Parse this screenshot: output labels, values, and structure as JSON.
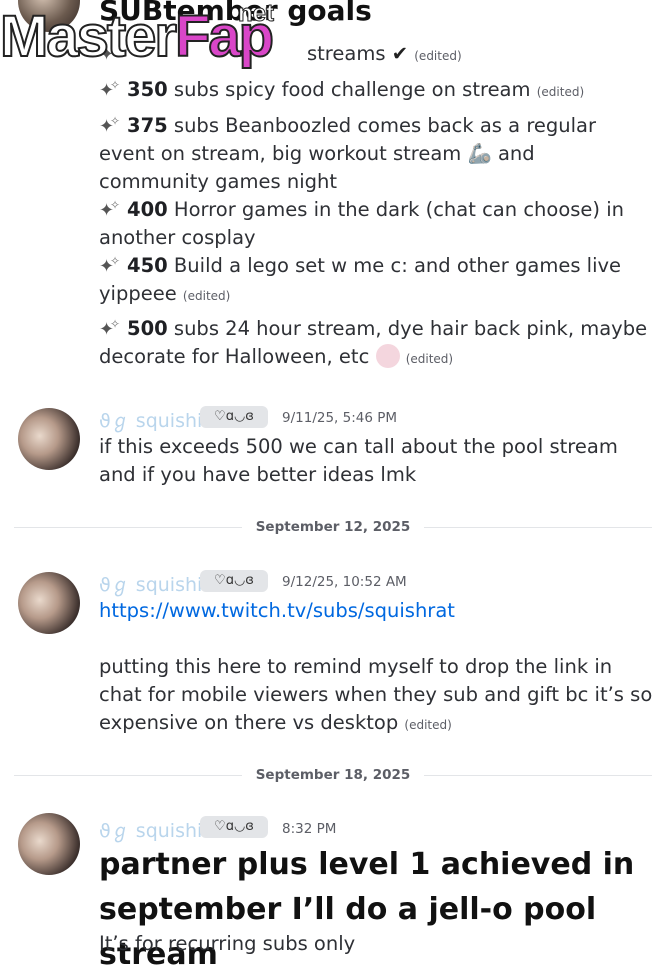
{
  "watermark": {
    "main": "Master",
    "accent": "Fap",
    "small": "net"
  },
  "goals_heading": "SUBtember goals",
  "goals": [
    {
      "lead": "",
      "text": "streams",
      "suffix": "✔",
      "edited": "(edited)"
    },
    {
      "lead": "350",
      "text": " subs spicy food challenge on stream",
      "edited": "(edited)"
    },
    {
      "lead": "375",
      "text": " subs Beanboozled comes back as a regular event on stream, big workout stream 🦾 and community games night",
      "edited": ""
    },
    {
      "lead": "400",
      "text": " Horror games in the dark (chat can choose) in another cosplay",
      "edited": ""
    },
    {
      "lead": "450",
      "text": " Build a lego set w me c: and other games live yippeee",
      "edited": "(edited)"
    },
    {
      "lead": "500",
      "text": " subs 24 hour stream, dye hair back pink, maybe decorate for Halloween, etc",
      "edited": "(edited)"
    }
  ],
  "messages": [
    {
      "username": "ϑℊ squishi",
      "badge": "♡ɑ◡ɞ",
      "timestamp": "9/11/25, 5:46 PM",
      "text": "if this exceeds 500 we can tall about the pool stream and if you have better ideas lmk"
    },
    {
      "username": "ϑℊ squishi",
      "badge": "♡ɑ◡ɞ",
      "timestamp": "9/12/25, 10:52 AM",
      "link": "https://www.twitch.tv/subs/squishrat",
      "text": "putting this here to remind myself to drop the link in chat for mobile viewers when they sub and gift bc it’s so expensive on there vs desktop",
      "edited": "(edited)"
    },
    {
      "username": "ϑℊ squishi",
      "badge": "♡ɑ◡ɞ",
      "timestamp": "8:32 PM",
      "big_text": "partner plus level 1 achieved in september I’ll do a jell-o pool stream",
      "text": "It’s for recurring subs only"
    }
  ],
  "dividers": [
    "September 12, 2025",
    "September 18, 2025"
  ]
}
